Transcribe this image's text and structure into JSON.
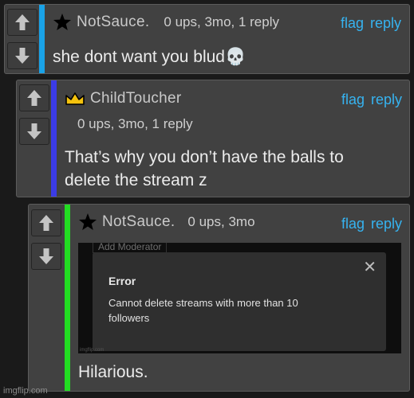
{
  "comments": [
    {
      "username": "NotSauce.",
      "badge": "black-star",
      "meta": "0 ups, 3mo, 1 reply",
      "flag": "flag",
      "reply": "reply",
      "text": "she dont want you blud💀",
      "depth_color": "#1aa3e8"
    },
    {
      "username": "ChildToucher",
      "badge": "gold-crown",
      "meta": "0 ups, 3mo, 1 reply",
      "flag": "flag",
      "reply": "reply",
      "text_line1": "That’s why you don’t have the balls to",
      "text_line2": "delete the stream z",
      "depth_color": "#3b3be6"
    },
    {
      "username": "NotSauce.",
      "badge": "black-star",
      "meta": "0 ups, 3mo",
      "flag": "flag",
      "reply": "reply",
      "text": "Hilarious.",
      "depth_color": "#22dd22",
      "embedded_image": {
        "tab_label": "Add Moderator",
        "dialog_title": "Error",
        "dialog_message": "Cannot delete streams with more than 10 followers",
        "close_glyph": "✕",
        "watermark": "imgflip.com"
      }
    }
  ],
  "watermark": "imgflip.com"
}
